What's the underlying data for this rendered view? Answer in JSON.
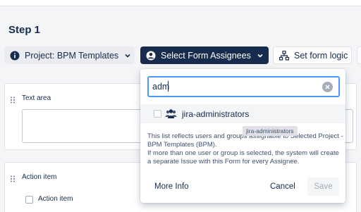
{
  "page": {
    "step_title": "Step 1"
  },
  "tabs": {
    "project": "Project: BPM Templates",
    "assignees": "Select Form Assignees",
    "logic": "Set form logic"
  },
  "cards": {
    "text_area_label": "Text area",
    "action_item_label": "Action item",
    "action_item_option": "Action item"
  },
  "popup": {
    "search_value": "adm",
    "option_label": "jira-administrators",
    "tooltip": "jira-administrators",
    "info_text": "This list reflects users and groups assignable to Selected Project - BPM Templates (BPM).\nIf more than one user or group is selected, the system will create a separate Issue with this Form for every Assignee.",
    "more_info": "More Info",
    "cancel": "Cancel",
    "save": "Save"
  },
  "icons": {
    "project": "info-circle-icon",
    "assignees": "user-avatar-icon",
    "logic": "sitemap-icon",
    "group": "people-group-icon",
    "clear": "clear-circle-icon"
  },
  "colors": {
    "accent": "#172b4d",
    "focus": "#4c9aff",
    "background": "#f4f5f7"
  }
}
